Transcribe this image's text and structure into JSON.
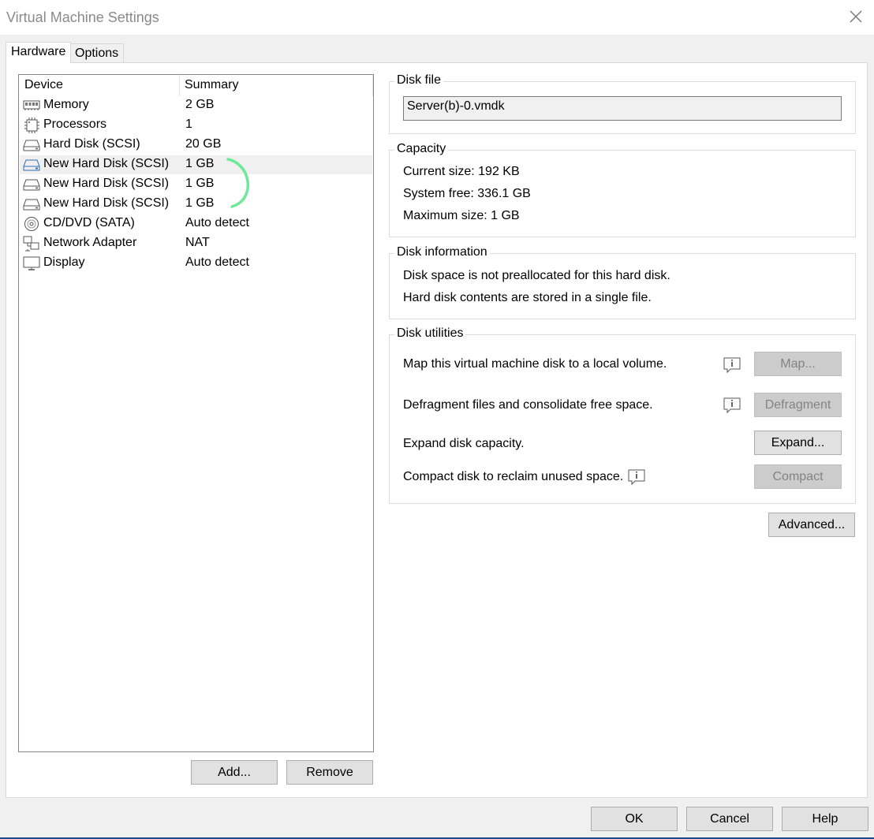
{
  "window": {
    "title": "Virtual Machine Settings"
  },
  "tabs": [
    {
      "label": "Hardware",
      "active": true
    },
    {
      "label": "Options",
      "active": false
    }
  ],
  "device_list": {
    "headers": {
      "device": "Device",
      "summary": "Summary"
    },
    "rows": [
      {
        "icon": "memory-icon",
        "name": "Memory",
        "summary": "2 GB"
      },
      {
        "icon": "processor-icon",
        "name": "Processors",
        "summary": "1"
      },
      {
        "icon": "hard-disk-icon",
        "name": "Hard Disk (SCSI)",
        "summary": "20 GB"
      },
      {
        "icon": "hard-disk-icon",
        "name": "New Hard Disk (SCSI)",
        "summary": "1 GB",
        "selected": true
      },
      {
        "icon": "hard-disk-icon",
        "name": "New Hard Disk (SCSI)",
        "summary": "1 GB"
      },
      {
        "icon": "hard-disk-icon",
        "name": "New Hard Disk (SCSI)",
        "summary": "1 GB"
      },
      {
        "icon": "cd-dvd-icon",
        "name": "CD/DVD (SATA)",
        "summary": "Auto detect"
      },
      {
        "icon": "network-adapter-icon",
        "name": "Network Adapter",
        "summary": "NAT"
      },
      {
        "icon": "display-icon",
        "name": "Display",
        "summary": "Auto detect"
      }
    ]
  },
  "list_buttons": {
    "add": "Add...",
    "remove": "Remove"
  },
  "disk_file": {
    "title": "Disk file",
    "value": "Server(b)-0.vmdk"
  },
  "capacity": {
    "title": "Capacity",
    "current_size": "Current size:  192 KB",
    "system_free": "System free:  336.1 GB",
    "maximum_size": "Maximum size:  1 GB"
  },
  "disk_information": {
    "title": "Disk information",
    "line1": "Disk space is not preallocated for this hard disk.",
    "line2": "Hard disk contents are stored in a single file."
  },
  "disk_utilities": {
    "title": "Disk utilities",
    "map_text": "Map this virtual machine disk to a local volume.",
    "map_button": "Map...",
    "defrag_text": "Defragment files and consolidate free space.",
    "defrag_button": "Defragment",
    "expand_text": "Expand disk capacity.",
    "expand_button": "Expand...",
    "compact_text": "Compact disk to reclaim unused space.",
    "compact_button": "Compact"
  },
  "advanced_button": "Advanced...",
  "footer": {
    "ok": "OK",
    "cancel": "Cancel",
    "help": "Help"
  },
  "colors": {
    "annotation": "#6ee89a",
    "accent_line": "#1a4c8c"
  }
}
